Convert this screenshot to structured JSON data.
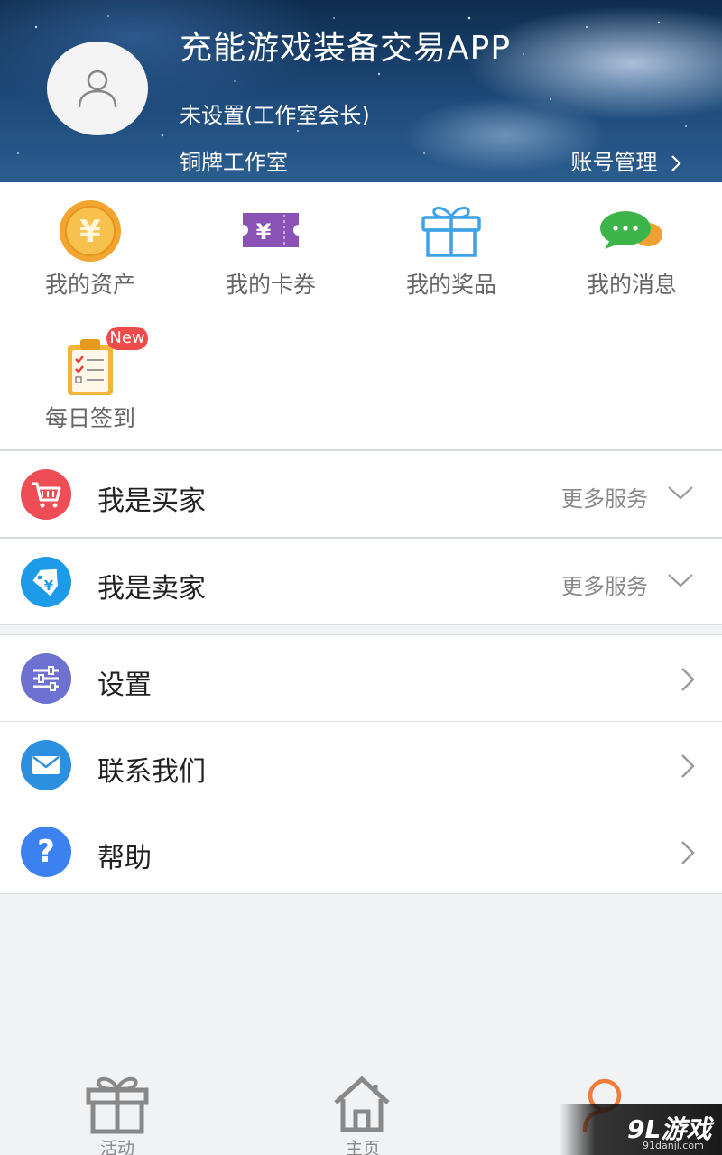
{
  "header": {
    "app_title": "充能游戏装备交易APP",
    "user_name": "未设置(工作室会长)",
    "studio": "铜牌工作室",
    "account_mgmt": "账号管理"
  },
  "quick_items": [
    {
      "label": "我的资产",
      "icon": "coin-yen-icon"
    },
    {
      "label": "我的卡券",
      "icon": "coupon-icon"
    },
    {
      "label": "我的奖品",
      "icon": "gift-icon"
    },
    {
      "label": "我的消息",
      "icon": "chat-bubble-icon"
    },
    {
      "label": "每日签到",
      "icon": "checklist-clipboard-icon",
      "badge": "New"
    }
  ],
  "rows": {
    "buyer": {
      "label": "我是买家",
      "more": "更多服务"
    },
    "seller": {
      "label": "我是卖家",
      "more": "更多服务"
    },
    "settings": {
      "label": "设置"
    },
    "contact": {
      "label": "联系我们"
    },
    "help": {
      "label": "帮助"
    }
  },
  "nav": {
    "activity": "活动",
    "home": "主页"
  },
  "watermark": {
    "brand": "9L游戏",
    "url": "91danji.com"
  },
  "colors": {
    "buyer_icon": "#ef4d56",
    "seller_icon": "#1e9be8",
    "settings_icon": "#6d71cf",
    "contact_icon": "#2c8fe0",
    "help_icon": "#3b82f0",
    "active_nav": "#f27b3a"
  }
}
